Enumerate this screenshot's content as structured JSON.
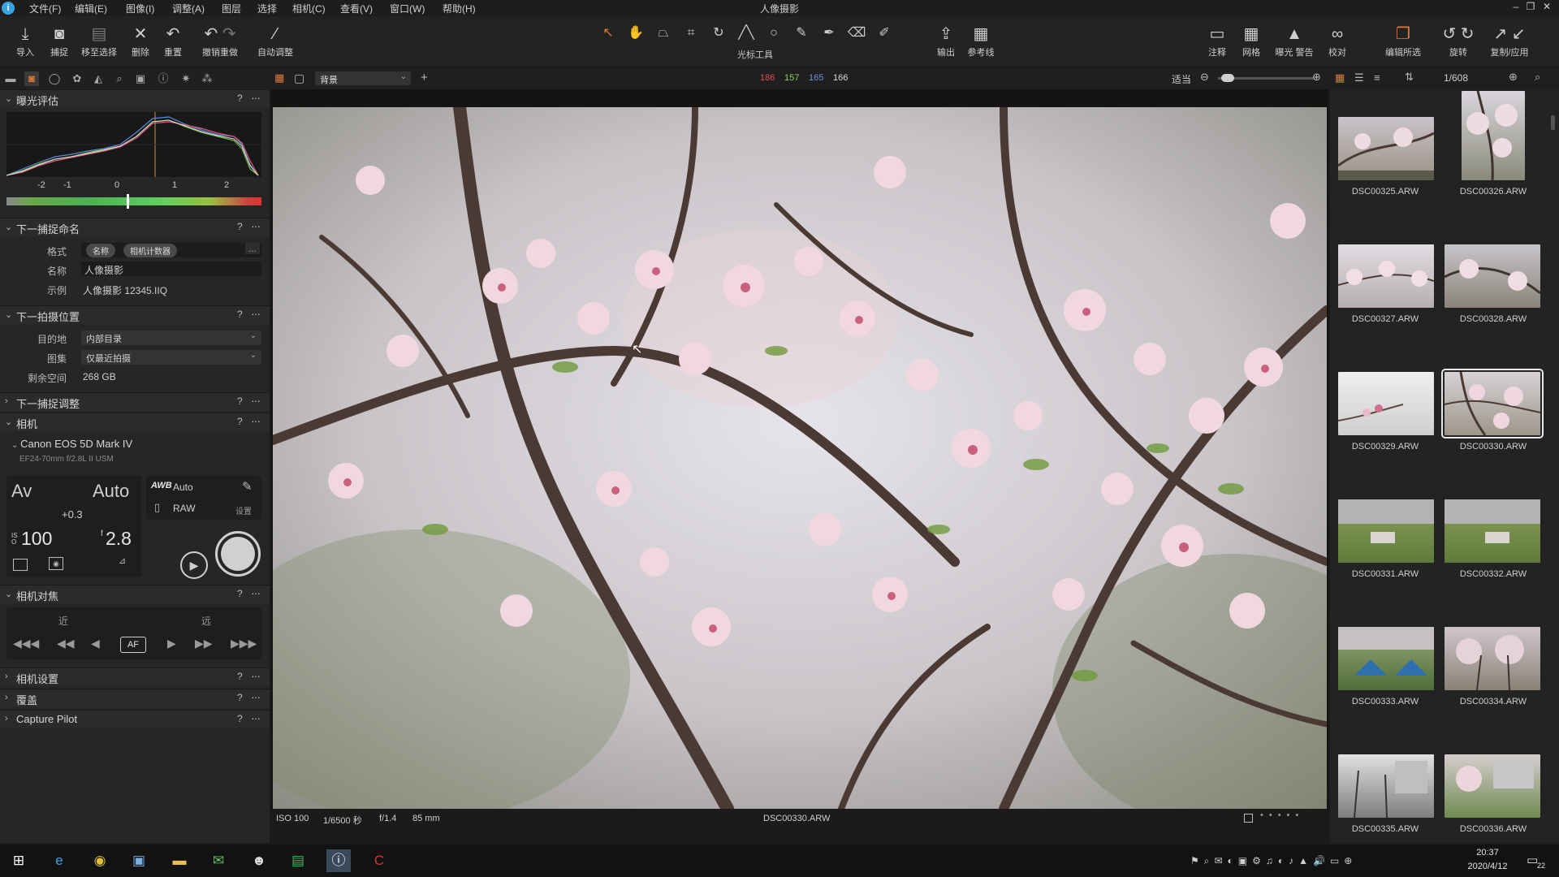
{
  "app": {
    "title": "人像摄影",
    "icon": "app-logo"
  },
  "menu": [
    "文件(F)",
    "编辑(E)",
    "图像(I)",
    "调整(A)",
    "图层",
    "选择",
    "相机(C)",
    "查看(V)",
    "窗口(W)",
    "帮助(H)"
  ],
  "toolbar": {
    "left": [
      {
        "label": "导入",
        "icon": "import-icon"
      },
      {
        "label": "捕捉",
        "icon": "camera-icon"
      },
      {
        "label": "移至选择",
        "icon": "move-to-selection-icon"
      },
      {
        "label": "删除",
        "icon": "delete-icon"
      },
      {
        "label": "重置",
        "icon": "reset-icon"
      },
      {
        "label": "撤销重做",
        "icon": "undo-redo-icon"
      },
      {
        "label": "自动调整",
        "icon": "auto-adjust-icon"
      }
    ],
    "cursor_tools_label": "光标工具",
    "cursor_tools": [
      "select",
      "pan",
      "keystone",
      "crop",
      "rotate",
      "straighten",
      "circle",
      "brush",
      "pen",
      "eraser",
      "gradient"
    ],
    "mid": [
      {
        "label": "输出",
        "icon": "output-icon"
      },
      {
        "label": "参考线",
        "icon": "guides-icon"
      }
    ],
    "right": [
      {
        "label": "注释",
        "icon": "annotate-icon"
      },
      {
        "label": "网格",
        "icon": "grid-icon"
      },
      {
        "label": "曝光 警告",
        "icon": "exposure-warning-icon"
      },
      {
        "label": "校对",
        "icon": "proof-icon"
      },
      {
        "label": "编辑所选",
        "icon": "edit-selected-icon"
      },
      {
        "label": "旋转",
        "icon": "rotate-icon"
      },
      {
        "label": "复制/应用",
        "icon": "copy-apply-icon"
      }
    ]
  },
  "viewer_bar": {
    "layer_select": "背景",
    "rgb": {
      "r": "186",
      "g": "157",
      "b": "165",
      "l": "166"
    },
    "fit_label": "适当"
  },
  "browser_bar": {
    "count": "1/608"
  },
  "exposure": {
    "title": "曝光评估",
    "ticks": [
      "-2",
      "-1",
      "0",
      "1",
      "2"
    ]
  },
  "next_capture_naming": {
    "title": "下一捕捉命名",
    "format_label": "格式",
    "format_tokens": [
      "名称",
      "相机计数器"
    ],
    "format_more": "...",
    "name_label": "名称",
    "name_value": "人像摄影",
    "example_label": "示例",
    "example_value": "人像摄影 12345.IIQ"
  },
  "next_capture_location": {
    "title": "下一拍摄位置",
    "dest_label": "目的地",
    "dest_value": "内部目录",
    "album_label": "图集",
    "album_value": "仅最近拍摄",
    "space_label": "剩余空间",
    "space_value": "268 GB"
  },
  "next_capture_adjust": {
    "title": "下一捕捉调整"
  },
  "camera": {
    "title": "相机",
    "model": "Canon EOS 5D Mark IV",
    "lens": "EF24-70mm f/2.8L II USM",
    "mode": "Av",
    "mode_auto": "Auto",
    "ev": "+0.3",
    "iso": "100",
    "aperture": "2.8",
    "wb": "Auto",
    "wb_icon": "AWB",
    "format": "RAW",
    "settings_label": "设置"
  },
  "camera_focus": {
    "title": "相机对焦",
    "near": "近",
    "far": "远",
    "af": "AF"
  },
  "camera_settings": {
    "title": "相机设置"
  },
  "overlay": {
    "title": "覆盖"
  },
  "capture_pilot": {
    "title": "Capture Pilot"
  },
  "help": "?",
  "status": {
    "iso": "ISO 100",
    "shutter": "1/6500 秒",
    "aperture": "f/1.4",
    "focal": "85 mm",
    "filename": "DSC00330.ARW"
  },
  "thumbnails": [
    {
      "name": "DSC00325.ARW"
    },
    {
      "name": "DSC00326.ARW"
    },
    {
      "name": "DSC00327.ARW"
    },
    {
      "name": "DSC00328.ARW"
    },
    {
      "name": "DSC00329.ARW"
    },
    {
      "name": "DSC00330.ARW",
      "selected": true
    },
    {
      "name": "DSC00331.ARW"
    },
    {
      "name": "DSC00332.ARW"
    },
    {
      "name": "DSC00333.ARW"
    },
    {
      "name": "DSC00334.ARW"
    },
    {
      "name": "DSC00335.ARW"
    },
    {
      "name": "DSC00336.ARW"
    }
  ],
  "taskbar": {
    "time": "20:37",
    "date": "2020/4/12",
    "notif": "22"
  }
}
